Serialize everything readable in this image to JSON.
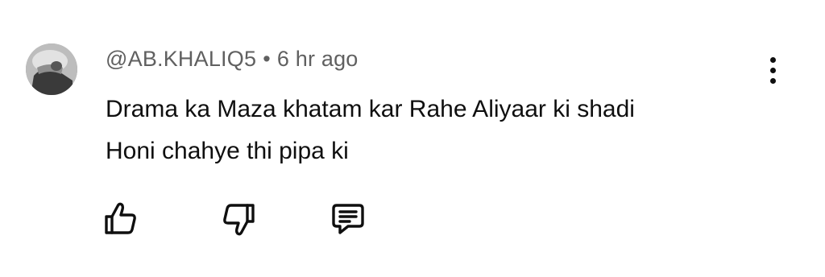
{
  "comment": {
    "author": "@AB.KHALIQ5",
    "separator": "•",
    "time": "6 hr ago",
    "text_line1": "Drama ka Maza khatam kar Rahe Aliyaar ki shadi",
    "text_line2": "Honi chahye thi pipa ki"
  },
  "icons": {
    "avatar": "avatar-image",
    "more": "more-vert-icon",
    "like": "thumbs-up-icon",
    "dislike": "thumbs-down-icon",
    "reply": "reply-comment-icon"
  },
  "colors": {
    "text": "#0f0f0f",
    "secondary_text": "#606060",
    "background": "#ffffff"
  }
}
